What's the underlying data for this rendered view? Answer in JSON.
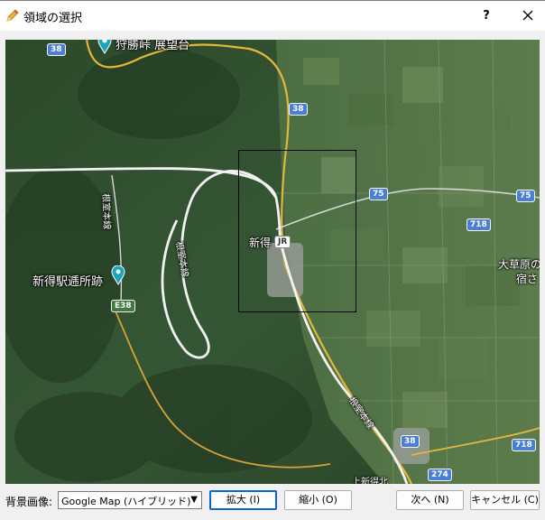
{
  "window": {
    "title": "領域の選択",
    "help": "?",
    "icon": "edit-pencil-icon"
  },
  "map": {
    "labels": {
      "lookout": "狩勝峠 展望台",
      "town": "新得",
      "ruins": "新得駅逓所跡",
      "line_vertical_left": "根室本線",
      "line_center": "根室本線",
      "line_bottom": "根室本線",
      "plain_line1": "大草原の",
      "plain_line2": "宿さ",
      "bottom_right": "上新得北"
    },
    "shields": {
      "r38_top": "38",
      "r38_mid": "38",
      "r38_bottom": "38",
      "r75_a": "75",
      "r75_b": "75",
      "r718_a": "718",
      "r718_b": "718",
      "r274": "274",
      "e38": "E38",
      "town_badge": "JR"
    }
  },
  "controls": {
    "background_label": "背景画像:",
    "background_value": "Google Map (ハイブリッド)",
    "zoom_in": "拡大 (I)",
    "zoom_out": "縮小 (O)",
    "next": "次へ (N)",
    "cancel": "キャンセル (C)"
  },
  "colors": {
    "focus_border": "#0a64d6",
    "shield_blue": "#4a7fd6",
    "pin_teal": "#1aa6b7"
  }
}
